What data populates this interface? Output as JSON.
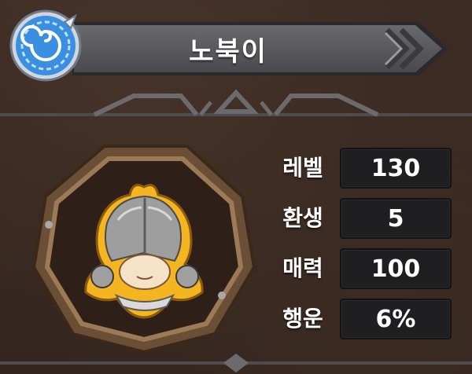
{
  "character": {
    "name": "노북이"
  },
  "stats": [
    {
      "label": "레벨",
      "value": "130"
    },
    {
      "label": "환생",
      "value": "5"
    },
    {
      "label": "매력",
      "value": "100"
    },
    {
      "label": "행운",
      "value": "6%"
    }
  ],
  "colors": {
    "background": "#3a2a22",
    "banner": "#5a5a5e",
    "emblem_blue": "#3b8fe0",
    "frame_wood": "#8a6a48",
    "stat_box": "#1f1f22"
  },
  "icons": {
    "emblem": "blue-spiral-emblem-icon",
    "banner_arrows": "chevron-right-icon",
    "divider": "ornament-icon"
  }
}
